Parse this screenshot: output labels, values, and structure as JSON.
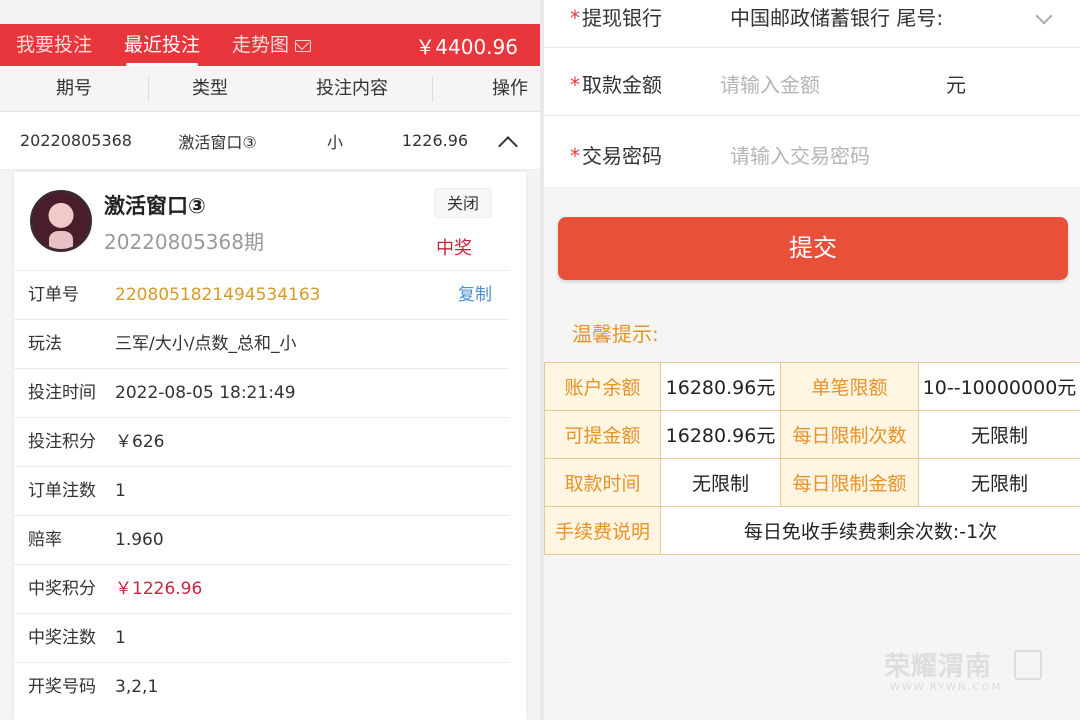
{
  "left": {
    "nav": {
      "tabs": [
        "我要投注",
        "最近投注",
        "走势图"
      ],
      "active_tab": "最近投注",
      "balance": "￥4400.96"
    },
    "table_headers": [
      "期号",
      "类型",
      "投注内容",
      "操作"
    ],
    "summary_row": {
      "issue": "20220805368",
      "type": "激活窗口③",
      "content": "小",
      "amount": "1226.96"
    },
    "detail": {
      "title": "激活窗口③",
      "issue_line": "20220805368期",
      "close_label": "关闭",
      "status": "中奖",
      "rows": [
        {
          "label": "订单号",
          "value": "2208051821494534163",
          "action": "复制"
        },
        {
          "label": "玩法",
          "value": "三军/大小/点数_总和_小"
        },
        {
          "label": "投注时间",
          "value": "2022-08-05 18:21:49"
        },
        {
          "label": "投注积分",
          "value": "￥626"
        },
        {
          "label": "订单注数",
          "value": "1"
        },
        {
          "label": "赔率",
          "value": "1.960"
        },
        {
          "label": "中奖积分",
          "value": "￥1226.96"
        },
        {
          "label": "中奖注数",
          "value": "1"
        },
        {
          "label": "开奖号码",
          "value": "3,2,1"
        }
      ]
    }
  },
  "right": {
    "form": {
      "bank_label": "提现银行",
      "bank_value": "中国邮政储蓄银行 尾号:",
      "amount_label": "取款金额",
      "amount_placeholder": "请输入金额",
      "amount_unit": "元",
      "password_label": "交易密码",
      "password_placeholder": "请输入交易密码",
      "required_mark": "*"
    },
    "submit_label": "提交",
    "tips_title": "温馨提示:",
    "info_table": {
      "r1": [
        "账户余额",
        "16280.96元",
        "单笔限额",
        "10--10000000元"
      ],
      "r2": [
        "可提金额",
        "16280.96元",
        "每日限制次数",
        "无限制"
      ],
      "r3": [
        "取款时间",
        "无限制",
        "每日限制金额",
        "无限制"
      ],
      "r4": [
        "手续费说明",
        "每日免收手续费剩余次数:-1次"
      ]
    },
    "watermark": {
      "text": "荣耀渭南",
      "sub": "WWW.RYWN.COM"
    }
  },
  "colors": {
    "nav_red": "#e8363d",
    "submit_red": "#e8503a",
    "tip_orange": "#e8932a",
    "order_no_orange": "#d89a27",
    "win_red": "#c8243c",
    "copy_blue": "#4a8fd4"
  }
}
